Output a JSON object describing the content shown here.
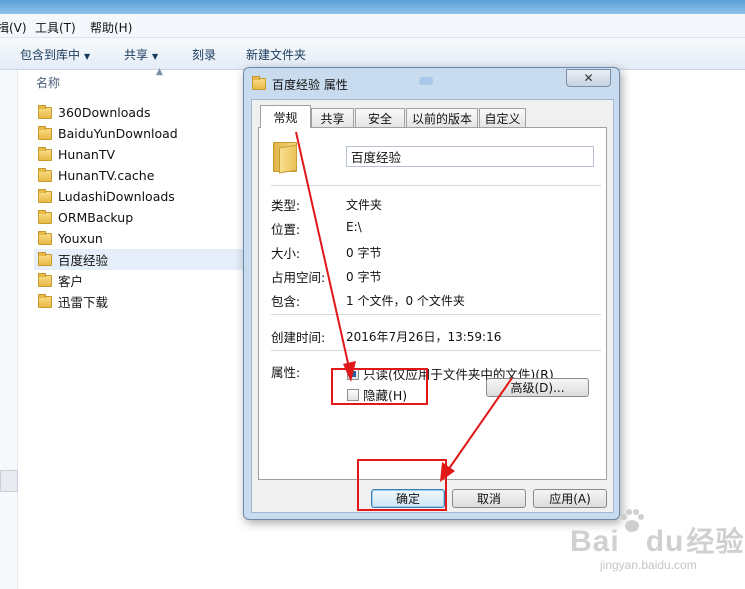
{
  "menubar": {
    "items": [
      {
        "label": "揖(V)"
      },
      {
        "label": "工具(T)"
      },
      {
        "label": "帮助(H)"
      }
    ]
  },
  "toolbar": {
    "include_library": "包含到库中",
    "share": "共享",
    "burn": "刻录",
    "new_folder": "新建文件夹"
  },
  "file_list": {
    "column_name": "名称",
    "items": [
      {
        "name": "360Downloads"
      },
      {
        "name": "BaiduYunDownload"
      },
      {
        "name": "HunanTV"
      },
      {
        "name": "HunanTV.cache"
      },
      {
        "name": "LudashiDownloads"
      },
      {
        "name": "ORMBackup"
      },
      {
        "name": "Youxun"
      },
      {
        "name": "百度经验",
        "selected": true
      },
      {
        "name": "客户"
      },
      {
        "name": "迅雷下载"
      }
    ]
  },
  "dialog": {
    "title": "百度经验 属性",
    "close_glyph": "✕",
    "tabs": [
      {
        "label": "常规",
        "active": true
      },
      {
        "label": "共享"
      },
      {
        "label": "安全"
      },
      {
        "label": "以前的版本"
      },
      {
        "label": "自定义"
      }
    ],
    "folder_name": "百度经验",
    "props": {
      "type_label": "类型:",
      "type_value": "文件夹",
      "location_label": "位置:",
      "location_value": "E:\\",
      "size_label": "大小:",
      "size_value": "0 字节",
      "size_on_disk_label": "占用空间:",
      "size_on_disk_value": "0 字节",
      "contains_label": "包含:",
      "contains_value": "1 个文件，0 个文件夹",
      "created_label": "创建时间:",
      "created_value": "2016年7月26日，13:59:16",
      "attributes_label": "属性:"
    },
    "readonly_label": "只读(仅应用于文件夹中的文件)(R)",
    "readonly_state": "indeterminate",
    "hidden_label": "隐藏(H)",
    "hidden_checked": false,
    "advanced_button": "高级(D)...",
    "ok_button": "确定",
    "cancel_button": "取消",
    "apply_button": "应用(A)"
  },
  "annotation_color": "#e01818",
  "watermark": {
    "logo_text": "Bai",
    "logo_text_2": "du",
    "logo_cn": "经验",
    "url": "jingyan.baidu.com"
  }
}
